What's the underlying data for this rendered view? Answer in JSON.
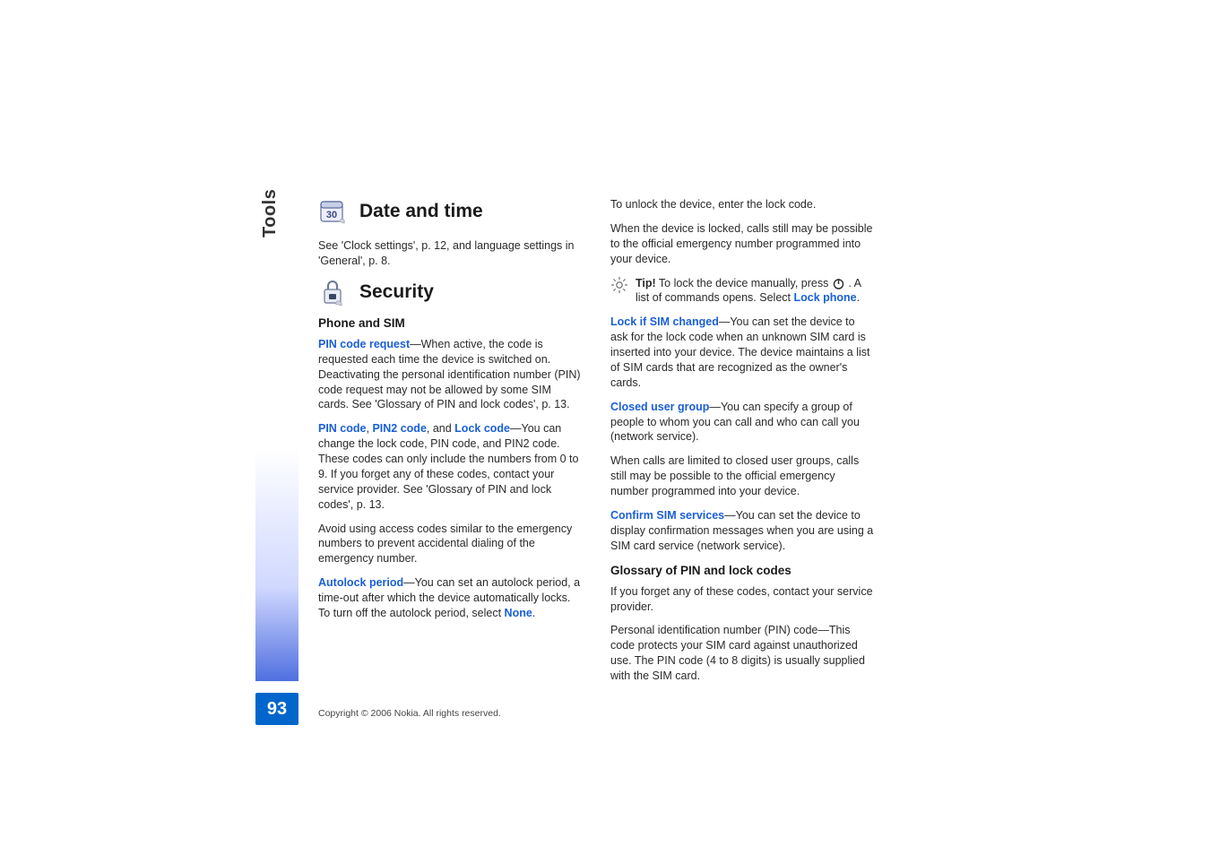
{
  "sidebar": {
    "chapter_label": "Tools",
    "page_number": "93"
  },
  "col1": {
    "date_time_title": "Date and time",
    "date_time_body": "See 'Clock settings', p. 12, and language settings in 'General', p. 8.",
    "security_title": "Security",
    "phone_sim_heading": "Phone and SIM",
    "pin_request_label": "PIN code request",
    "pin_request_body": "—When active, the code is requested each time the device is switched on. Deactivating the personal identification number (PIN) code request may not be allowed by some SIM cards. See 'Glossary of PIN and lock codes', p. 13.",
    "pin_code_label": "PIN code",
    "pin2_code_label": "PIN2 code",
    "lock_code_label": "Lock code",
    "codes_body": "—You can change the lock code, PIN code, and PIN2 code. These codes can only include the numbers from 0 to 9. If you forget any of these codes, contact your service provider. See 'Glossary of PIN and lock codes', p. 13.",
    "avoid_body": "Avoid using access codes similar to the emergency numbers to prevent accidental dialing of the emergency number.",
    "autolock_label": "Autolock period",
    "autolock_body_a": "—You can set an autolock period, a time-out after which the device automatically locks. To turn off the autolock period, select ",
    "autolock_none": "None",
    "autolock_body_b": "."
  },
  "col2": {
    "unlock_body": "To unlock the device, enter the lock code.",
    "locked_calls_body": "When the device is locked, calls still may be possible to the official emergency number programmed into your device.",
    "tip_bold": "Tip!",
    "tip_body_a": " To lock the device manually, press ",
    "tip_body_b": " . A list of commands opens. Select ",
    "tip_lockphone": "Lock phone",
    "tip_body_c": ".",
    "lock_sim_label": "Lock if SIM changed",
    "lock_sim_body": "—You can set the device to ask for the lock code when an unknown SIM card is inserted into your device. The device maintains a list of SIM cards that are recognized as the owner's cards.",
    "cug_label": "Closed user group",
    "cug_body": "—You can specify a group of people to whom you can call and who can call you (network service).",
    "cug_limited_body": "When calls are limited to closed user groups, calls still may be possible to the official emergency number programmed into your device.",
    "confirm_sim_label": "Confirm SIM services",
    "confirm_sim_body": "—You can set the device to display confirmation messages when you are using a SIM card service (network service).",
    "glossary_heading": "Glossary of PIN and lock codes",
    "glossary_body1": "If you forget any of these codes, contact your service provider.",
    "glossary_body2": "Personal identification number (PIN) code—This code protects your SIM card against unauthorized use. The PIN code (4 to 8 digits) is usually supplied with the SIM card."
  },
  "footer": {
    "copyright": "Copyright © 2006 Nokia. All rights reserved."
  }
}
